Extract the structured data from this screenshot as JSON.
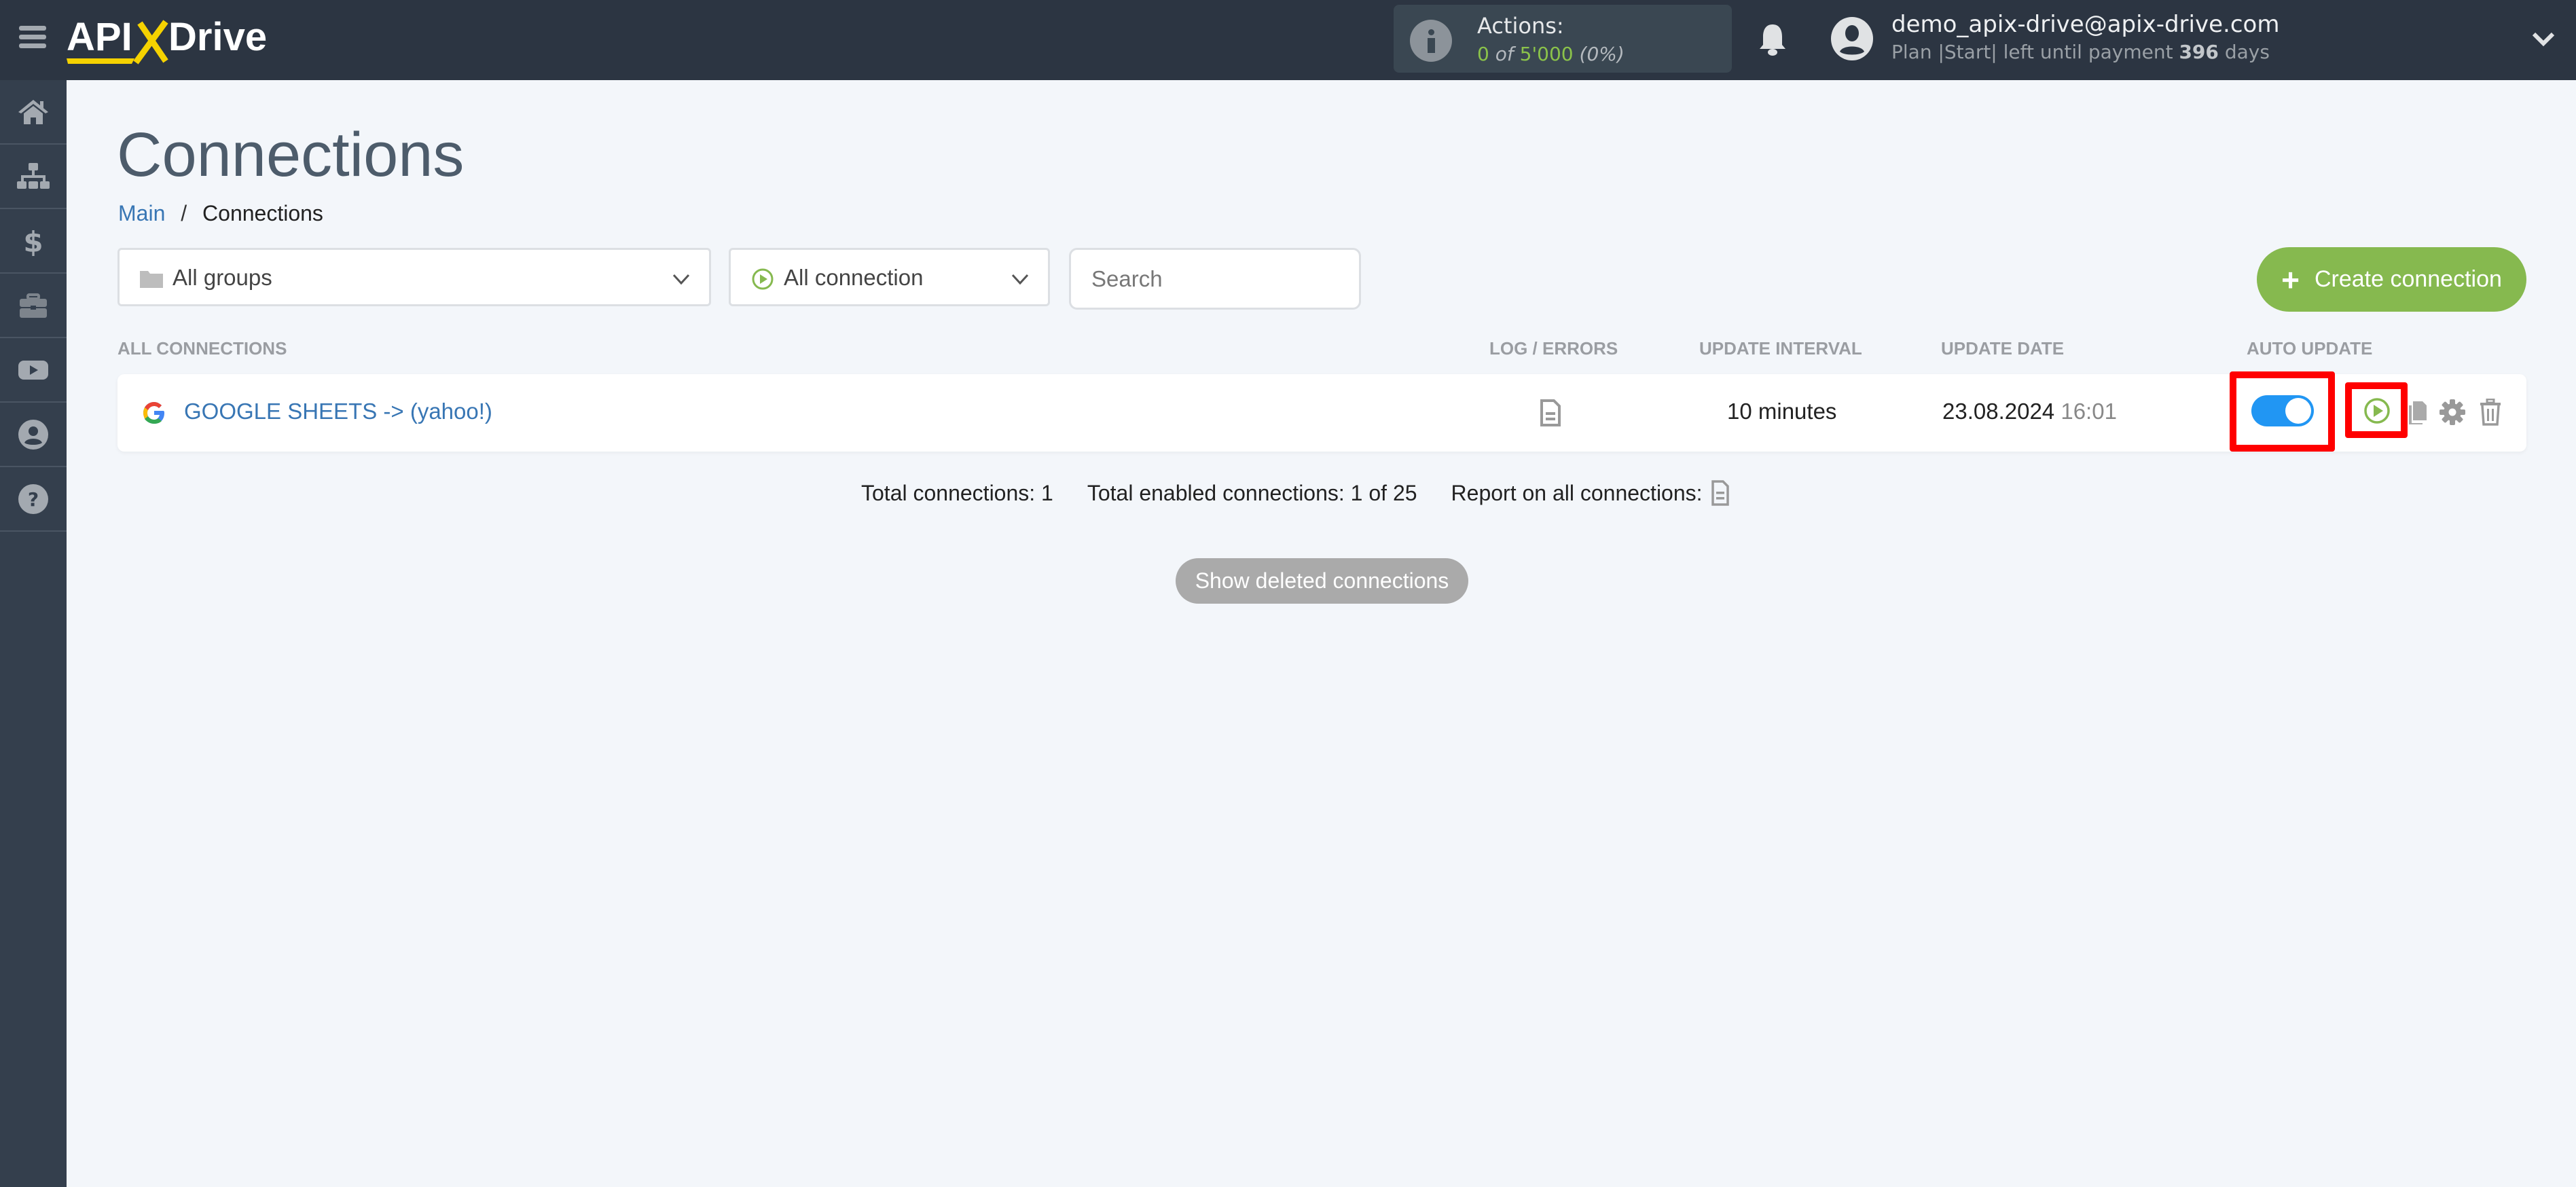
{
  "app": {
    "brand": "APIXDrive",
    "brand_parts": [
      "API",
      "X",
      "Drive"
    ]
  },
  "topbar": {
    "actions_label": "Actions:",
    "actions_used": "0",
    "actions_of": "of",
    "actions_total": "5'000",
    "actions_percent": "(0%)",
    "user_email": "demo_apix-drive@apix-drive.com",
    "plan_prefix": "Plan |Start| left until payment",
    "plan_days": "396",
    "plan_suffix": "days"
  },
  "sidebar": {
    "items": [
      {
        "name": "home",
        "icon": "home-icon"
      },
      {
        "name": "connections",
        "icon": "sitemap-icon"
      },
      {
        "name": "billing",
        "icon": "dollar-icon"
      },
      {
        "name": "tools",
        "icon": "briefcase-icon"
      },
      {
        "name": "video",
        "icon": "youtube-icon"
      },
      {
        "name": "account",
        "icon": "user-circle-icon"
      },
      {
        "name": "help",
        "icon": "question-circle-icon"
      }
    ]
  },
  "page": {
    "title": "Connections",
    "breadcrumb": [
      {
        "label": "Main",
        "link": true
      },
      {
        "label": "Connections",
        "link": false
      }
    ],
    "breadcrumb_sep": "/"
  },
  "filters": {
    "groups_selected": "All groups",
    "connection_selected": "All connection",
    "search_placeholder": "Search",
    "search_value": "",
    "create_label": "Create connection"
  },
  "table": {
    "columns": [
      "ALL CONNECTIONS",
      "LOG / ERRORS",
      "UPDATE INTERVAL",
      "UPDATE DATE",
      "AUTO UPDATE"
    ],
    "rows": [
      {
        "name": "GOOGLE SHEETS -> (yahoo!)",
        "source_icon": "google-icon",
        "interval": "10 minutes",
        "date": "23.08.2024",
        "time": "16:01",
        "auto_update": true
      }
    ]
  },
  "summary": {
    "total": "Total connections: 1",
    "enabled": "Total enabled connections: 1 of 25",
    "report": "Report on all connections:"
  },
  "show_deleted_label": "Show deleted connections",
  "colors": {
    "topbar": "#2c3542",
    "sidebar": "#343f4d",
    "accent_green": "#86b94f",
    "link_blue": "#3876b4",
    "toggle_blue": "#2196f3",
    "highlight_red": "#ff0000",
    "logo_yellow": "#f5d200"
  }
}
